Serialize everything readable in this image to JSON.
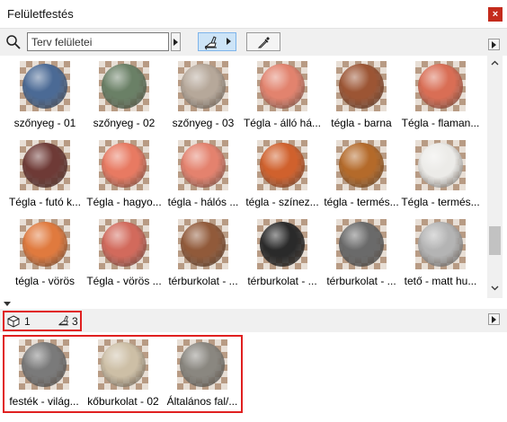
{
  "window": {
    "title": "Felületfestés",
    "close_glyph": "×"
  },
  "toolbar": {
    "search_placeholder": "Terv felületei",
    "icons": [
      "search-icon",
      "paint-brush-icon",
      "eyedropper-icon"
    ]
  },
  "materials": [
    {
      "label": "szőnyeg - 01",
      "color": "#4b6a95"
    },
    {
      "label": "szőnyeg - 02",
      "color": "#6a8066"
    },
    {
      "label": "szőnyeg - 03",
      "color": "#b6a89a"
    },
    {
      "label": "Tégla - álló há...",
      "color": "#e2836e"
    },
    {
      "label": "tégla - barna",
      "color": "#9c5534"
    },
    {
      "label": "Tégla - flaman...",
      "color": "#d96e55"
    },
    {
      "label": "Tégla - futó k...",
      "color": "#6e3a36"
    },
    {
      "label": "Tégla - hagyo...",
      "color": "#e87a62"
    },
    {
      "label": "tégla - hálós ...",
      "color": "#e4826e"
    },
    {
      "label": "tégla - színez...",
      "color": "#d0612d"
    },
    {
      "label": "tégla - termés...",
      "color": "#b46a2a"
    },
    {
      "label": "Tégla - termés...",
      "color": "#ecebe8"
    },
    {
      "label": "tégla - vörös",
      "color": "#e07a3e"
    },
    {
      "label": "Tégla - vörös ...",
      "color": "#d26a5c"
    },
    {
      "label": "térburkolat - ...",
      "color": "#915a3a"
    },
    {
      "label": "térburkolat - ...",
      "color": "#2a2a2a"
    },
    {
      "label": "térburkolat - ...",
      "color": "#6a6a6a"
    },
    {
      "label": "tető - matt hu...",
      "color": "#b4b4b4"
    }
  ],
  "status": {
    "objects_count": "1",
    "surfaces_count": "3"
  },
  "project_surfaces": [
    {
      "label": "festék - világ...",
      "color": "#7a7a7a"
    },
    {
      "label": "kőburkolat - 02",
      "color": "#cdbfa6"
    },
    {
      "label": "Általános fal/...",
      "color": "#8a8780"
    }
  ]
}
